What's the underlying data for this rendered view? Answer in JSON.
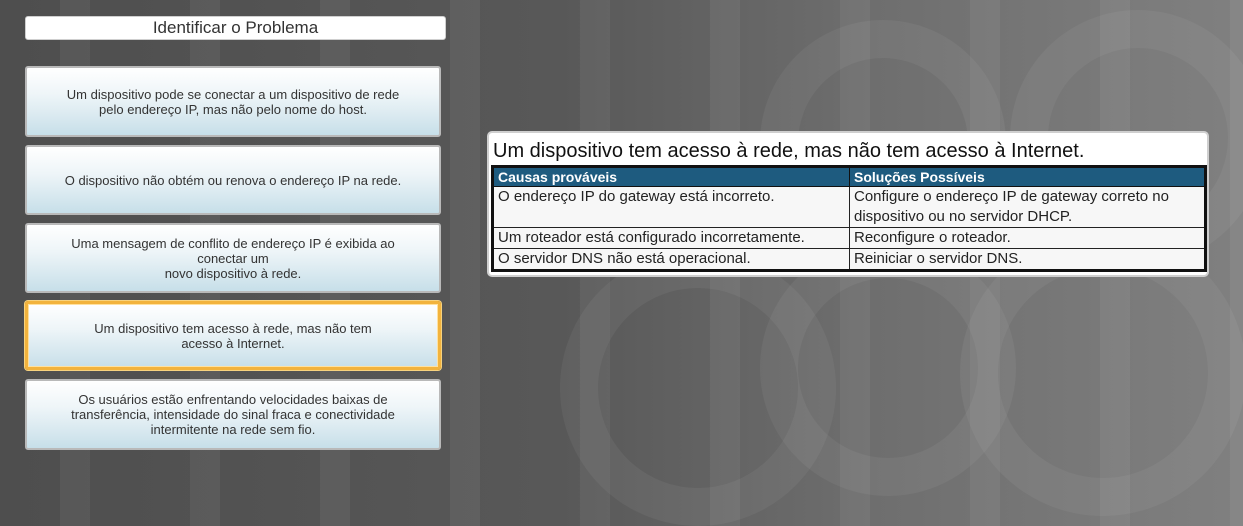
{
  "header": {
    "title": "Identificar o Problema"
  },
  "problems": [
    {
      "text": "Um dispositivo pode se conectar a um dispositivo de rede\npelo endereço IP, mas não pelo nome do host.",
      "selected": false
    },
    {
      "text": "O dispositivo não obtém ou renova o endereço IP na rede.",
      "selected": false
    },
    {
      "text": "Uma mensagem de conflito de endereço IP é exibida ao\nconectar um\nnovo dispositivo à rede.",
      "selected": false
    },
    {
      "text": "Um dispositivo tem acesso à rede, mas não tem\nacesso à Internet.",
      "selected": true
    },
    {
      "text": "Os usuários estão enfrentando velocidades baixas de\ntransferência, intensidade do sinal fraca e conectividade\nintermitente na rede sem fio.",
      "selected": false
    }
  ],
  "panel": {
    "heading": "Um dispositivo tem acesso à rede, mas não tem acesso à Internet.",
    "columns": [
      "Causas prováveis",
      "Soluções Possíveis"
    ],
    "rows": [
      [
        "O endereço IP do gateway está incorreto.",
        "Configure o endereço IP de gateway correto no dispositivo ou no servidor DHCP."
      ],
      [
        "Um roteador está configurado incorretamente.",
        "Reconfigure o roteador."
      ],
      [
        "O servidor DNS não está operacional.",
        "Reiniciar o servidor DNS."
      ]
    ]
  },
  "colors": {
    "selected_border": "#f2b33d",
    "table_header_bg": "#1e5b7f"
  }
}
